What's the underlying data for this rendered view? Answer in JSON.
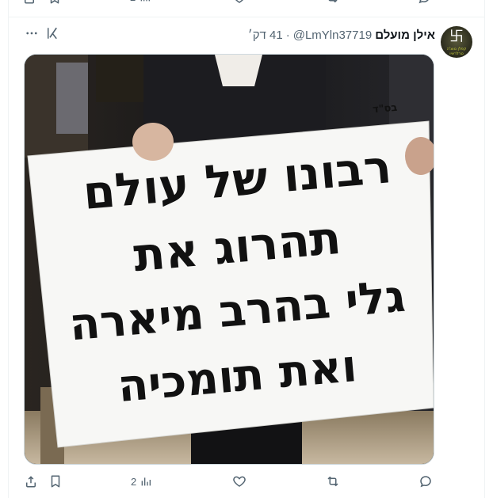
{
  "previous_tweet": {
    "views_count": "2"
  },
  "tweet": {
    "display_name": "אילן מועלם",
    "handle": "@LmYln37719",
    "separator": "·",
    "timestamp": "41 דק׳",
    "avatar_symbol": "卐",
    "avatar_caption": "קפלן נווצ'ה טרלראיו",
    "image_text": {
      "corner": "בס\"ד",
      "line1": "רבונו של עולם",
      "line2": "תהרוג את",
      "line3": "גלי בהרב מיארה",
      "line4": "ואת תומכיה"
    },
    "actions": {
      "views_count": "2"
    }
  },
  "icons": {
    "share": "share-icon",
    "bookmark": "bookmark-icon",
    "views": "views-icon",
    "like": "heart-icon",
    "retweet": "retweet-icon",
    "reply": "reply-icon",
    "more": "more-icon",
    "grok": "grok-icon"
  },
  "colors": {
    "text_primary": "#0f1419",
    "text_secondary": "#536471",
    "border": "#eff3f4"
  }
}
